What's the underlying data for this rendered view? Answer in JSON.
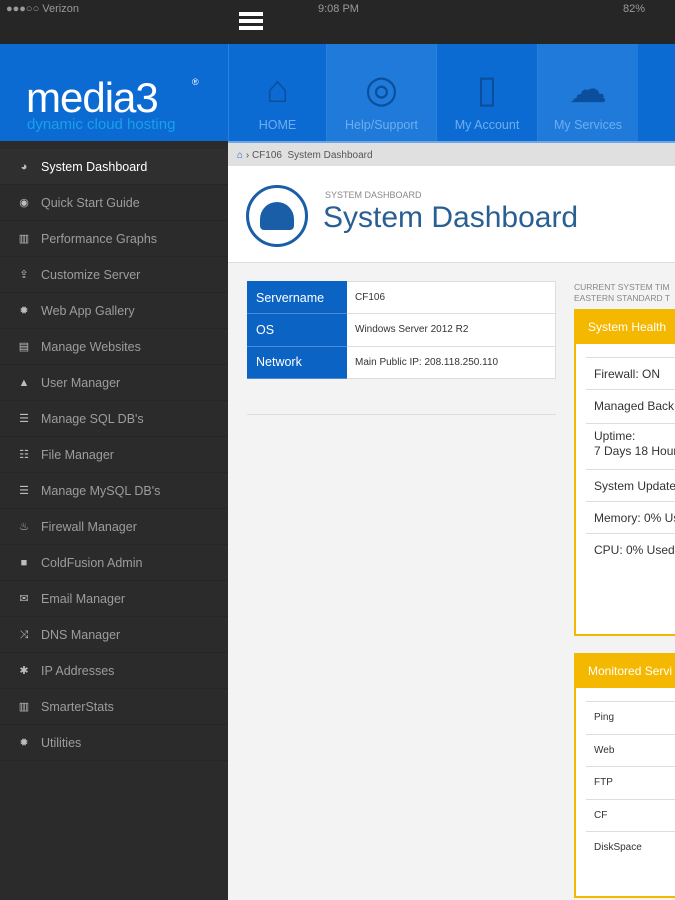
{
  "status_bar": {
    "carrier": "●●●○○ Verizon",
    "time": "9:08 PM",
    "battery": "82%"
  },
  "header": {
    "logo": "media3",
    "logo_mark": "®",
    "tagline": "dynamic cloud hosting",
    "nav": [
      {
        "label": "HOME",
        "icon": "home-icon"
      },
      {
        "label": "Help/Support",
        "icon": "lifebuoy-icon"
      },
      {
        "label": "My Account",
        "icon": "list-icon"
      },
      {
        "label": "My Services",
        "icon": "cloud-icon"
      }
    ]
  },
  "sidebar": {
    "items": [
      {
        "label": "System Dashboard",
        "icon": "dashboard-icon",
        "glyph": "◕",
        "active": true
      },
      {
        "label": "Quick Start Guide",
        "icon": "eye-icon",
        "glyph": "◉"
      },
      {
        "label": "Performance Graphs",
        "icon": "bar-chart-icon",
        "glyph": "▥"
      },
      {
        "label": "Customize Server",
        "icon": "upload-icon",
        "glyph": "⇪"
      },
      {
        "label": "Web App Gallery",
        "icon": "gear-icon",
        "glyph": "✹"
      },
      {
        "label": "Manage Websites",
        "icon": "browser-icon",
        "glyph": "▤"
      },
      {
        "label": "User Manager",
        "icon": "user-icon",
        "glyph": "▲"
      },
      {
        "label": "Manage SQL DB's",
        "icon": "database-icon",
        "glyph": "☰"
      },
      {
        "label": "File Manager",
        "icon": "list-icon",
        "glyph": "☷"
      },
      {
        "label": "Manage MySQL DB's",
        "icon": "database-icon",
        "glyph": "☰"
      },
      {
        "label": "Firewall Manager",
        "icon": "fire-icon",
        "glyph": "♨"
      },
      {
        "label": "ColdFusion Admin",
        "icon": "square-icon",
        "glyph": "■"
      },
      {
        "label": "Email Manager",
        "icon": "envelope-icon",
        "glyph": "✉"
      },
      {
        "label": "DNS Manager",
        "icon": "shuffle-icon",
        "glyph": "⤨"
      },
      {
        "label": "IP Addresses",
        "icon": "asterisk-icon",
        "glyph": "✱"
      },
      {
        "label": "SmarterStats",
        "icon": "bar-chart-icon",
        "glyph": "▥"
      },
      {
        "label": "Utilities",
        "icon": "gear-icon",
        "glyph": "✹"
      }
    ]
  },
  "breadcrumb": {
    "server": "CF106",
    "page": "System Dashboard"
  },
  "page": {
    "subtitle": "SYSTEM DASHBOARD",
    "title": "System Dashboard"
  },
  "server_info": [
    {
      "key": "Servername",
      "value": "CF106"
    },
    {
      "key": "OS",
      "value": "Windows Server 2012 R2"
    },
    {
      "key": "Network",
      "value": "Main Public IP: 208.118.250.110"
    }
  ],
  "system_time": {
    "line1": "CURRENT SYSTEM TIM",
    "line2": "EASTERN STANDARD T"
  },
  "system_health": {
    "title": "System Health",
    "items": [
      "Firewall: ON",
      "Managed Back",
      "Uptime:\n7 Days 18 Hour",
      "System Update",
      "Memory: 0% Us",
      "CPU: 0% Used"
    ]
  },
  "monitored": {
    "title": "Monitored Servi",
    "items": [
      "Ping",
      "Web",
      "FTP",
      "CF",
      "DiskSpace"
    ]
  },
  "colors": {
    "brand_blue": "#0b6bd3",
    "accent_yellow": "#f5b800",
    "sidebar": "#2b2b2b"
  }
}
